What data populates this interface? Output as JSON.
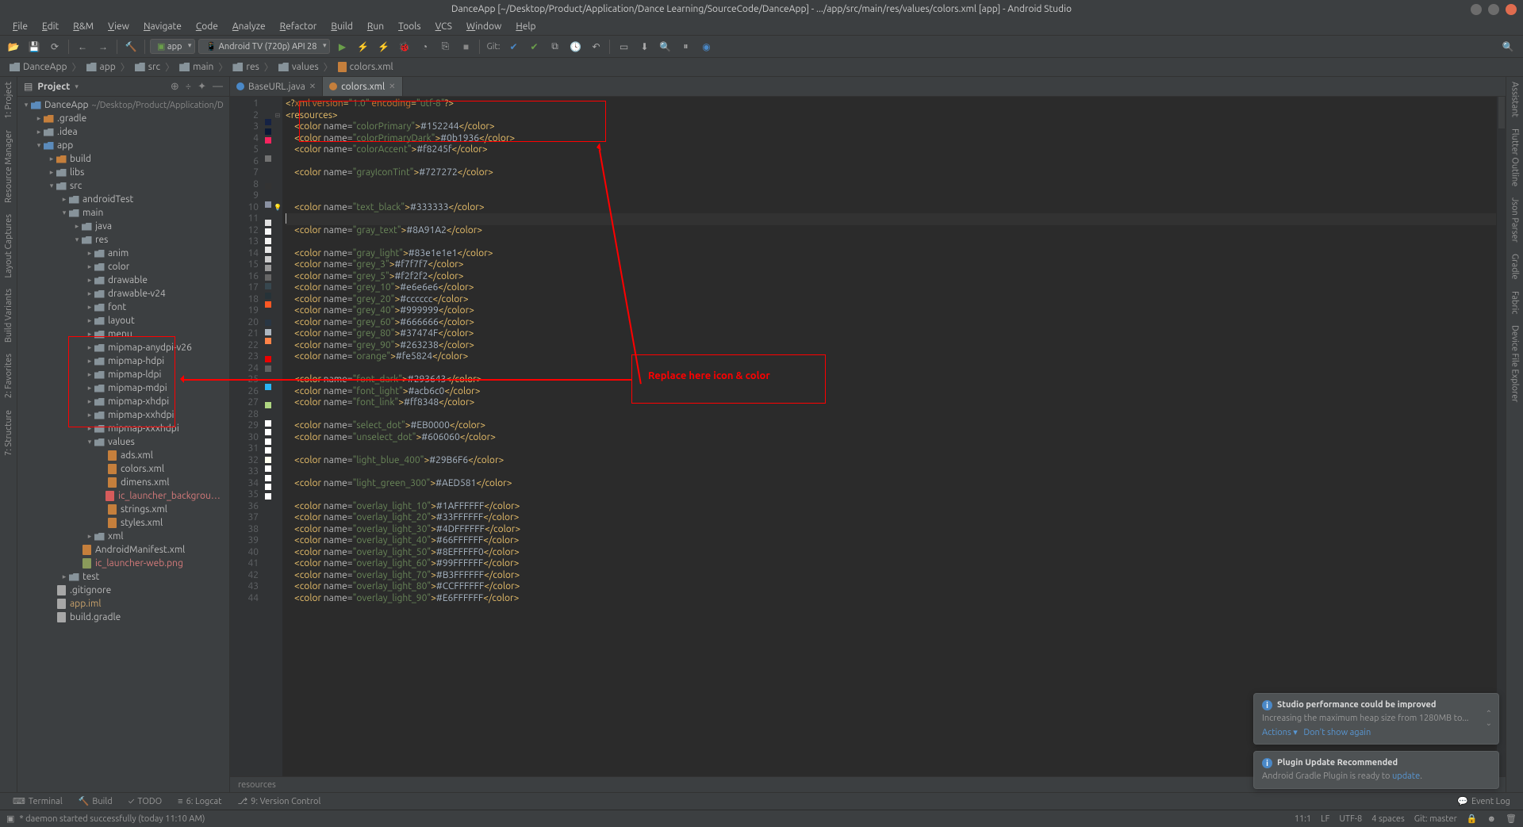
{
  "window": {
    "title": "DanceApp [~/Desktop/Product/Application/Dance Learning/SourceCode/DanceApp] - .../app/src/main/res/values/colors.xml [app] - Android Studio"
  },
  "menu": [
    "File",
    "Edit",
    "R&M",
    "View",
    "Navigate",
    "Code",
    "Analyze",
    "Refactor",
    "Build",
    "Run",
    "Tools",
    "VCS",
    "Window",
    "Help"
  ],
  "toolbar": {
    "config": "app",
    "device": "Android TV (720p) API 28",
    "git_label": "Git:"
  },
  "breadcrumb": [
    {
      "label": "DanceApp",
      "type": "project"
    },
    {
      "label": "app",
      "type": "module"
    },
    {
      "label": "src",
      "type": "folder"
    },
    {
      "label": "main",
      "type": "folder"
    },
    {
      "label": "res",
      "type": "folder"
    },
    {
      "label": "values",
      "type": "folder"
    },
    {
      "label": "colors.xml",
      "type": "file"
    }
  ],
  "project_panel": {
    "title": "Project",
    "root": "DanceApp",
    "root_path": "~/Desktop/Product/Application/D",
    "tree": [
      {
        "d": 0,
        "ar": "▾",
        "ic": "folder-root",
        "label": "DanceApp",
        "suffix": "~/Desktop/Product/Application/D"
      },
      {
        "d": 1,
        "ar": "▸",
        "ic": "folder-orange",
        "label": ".gradle"
      },
      {
        "d": 1,
        "ar": "▸",
        "ic": "folder",
        "label": ".idea"
      },
      {
        "d": 1,
        "ar": "▾",
        "ic": "folder-blue",
        "label": "app"
      },
      {
        "d": 2,
        "ar": "▸",
        "ic": "folder-orange",
        "label": "build"
      },
      {
        "d": 2,
        "ar": "▸",
        "ic": "folder",
        "label": "libs"
      },
      {
        "d": 2,
        "ar": "▾",
        "ic": "folder",
        "label": "src"
      },
      {
        "d": 3,
        "ar": "▸",
        "ic": "folder",
        "label": "androidTest"
      },
      {
        "d": 3,
        "ar": "▾",
        "ic": "folder",
        "label": "main"
      },
      {
        "d": 4,
        "ar": "▸",
        "ic": "folder",
        "label": "java"
      },
      {
        "d": 4,
        "ar": "▾",
        "ic": "folder",
        "label": "res"
      },
      {
        "d": 5,
        "ar": "▸",
        "ic": "folder",
        "label": "anim"
      },
      {
        "d": 5,
        "ar": "▸",
        "ic": "folder",
        "label": "color"
      },
      {
        "d": 5,
        "ar": "▸",
        "ic": "folder",
        "label": "drawable"
      },
      {
        "d": 5,
        "ar": "▸",
        "ic": "folder",
        "label": "drawable-v24"
      },
      {
        "d": 5,
        "ar": "▸",
        "ic": "folder",
        "label": "font"
      },
      {
        "d": 5,
        "ar": "▸",
        "ic": "folder",
        "label": "layout"
      },
      {
        "d": 5,
        "ar": "▸",
        "ic": "folder",
        "label": "menu"
      },
      {
        "d": 5,
        "ar": "▸",
        "ic": "folder",
        "label": "mipmap-anydpi-v26"
      },
      {
        "d": 5,
        "ar": "▸",
        "ic": "folder",
        "label": "mipmap-hdpi"
      },
      {
        "d": 5,
        "ar": "▸",
        "ic": "folder",
        "label": "mipmap-ldpi"
      },
      {
        "d": 5,
        "ar": "▸",
        "ic": "folder",
        "label": "mipmap-mdpi"
      },
      {
        "d": 5,
        "ar": "▸",
        "ic": "folder",
        "label": "mipmap-xhdpi"
      },
      {
        "d": 5,
        "ar": "▸",
        "ic": "folder",
        "label": "mipmap-xxhdpi"
      },
      {
        "d": 5,
        "ar": "▸",
        "ic": "folder",
        "label": "mipmap-xxxhdpi"
      },
      {
        "d": 5,
        "ar": "▾",
        "ic": "folder",
        "label": "values"
      },
      {
        "d": 6,
        "ar": "",
        "ic": "file-xml",
        "label": "ads.xml"
      },
      {
        "d": 6,
        "ar": "",
        "ic": "file-xml",
        "label": "colors.xml"
      },
      {
        "d": 6,
        "ar": "",
        "ic": "file-xml",
        "label": "dimens.xml"
      },
      {
        "d": 6,
        "ar": "",
        "ic": "file-xml-r",
        "label": "ic_launcher_background.xml",
        "red": true
      },
      {
        "d": 6,
        "ar": "",
        "ic": "file-xml",
        "label": "strings.xml"
      },
      {
        "d": 6,
        "ar": "",
        "ic": "file-xml",
        "label": "styles.xml"
      },
      {
        "d": 5,
        "ar": "▸",
        "ic": "folder",
        "label": "xml"
      },
      {
        "d": 4,
        "ar": "",
        "ic": "file-xml",
        "label": "AndroidManifest.xml"
      },
      {
        "d": 4,
        "ar": "",
        "ic": "file-png",
        "label": "ic_launcher-web.png",
        "red": true
      },
      {
        "d": 3,
        "ar": "▸",
        "ic": "folder",
        "label": "test"
      },
      {
        "d": 2,
        "ar": "",
        "ic": "file",
        "label": ".gitignore"
      },
      {
        "d": 2,
        "ar": "",
        "ic": "file",
        "label": "app.iml",
        "orange": true
      },
      {
        "d": 2,
        "ar": "",
        "ic": "file",
        "label": "build.gradle"
      }
    ]
  },
  "editor": {
    "tabs": [
      {
        "label": "BaseURL.java",
        "type": "java",
        "active": false
      },
      {
        "label": "colors.xml",
        "type": "xml",
        "active": true
      }
    ],
    "breadcrumb_bottom": "resources",
    "lines": [
      {
        "n": 1,
        "c": "",
        "html": "<span class='tk-decl'>&lt;?</span><span class='tk-pi'>xml version</span><span class='tk-decl'>=</span><span class='tk-str'>\"1.0\"</span> <span class='tk-pi'>encoding</span><span class='tk-decl'>=</span><span class='tk-str'>\"utf-8\"</span><span class='tk-decl'>?&gt;</span>"
      },
      {
        "n": 2,
        "c": "",
        "fold": "⊟",
        "html": "<span class='tk-tag'>&lt;resources&gt;</span>"
      },
      {
        "n": 3,
        "c": "#152244",
        "html": "    <span class='tk-tag'>&lt;color </span><span class='tk-attr'>name=</span><span class='tk-str'>\"colorPrimary\"</span><span class='tk-tag'>&gt;</span>#152244<span class='tk-tag'>&lt;/color&gt;</span>"
      },
      {
        "n": 4,
        "c": "#0b1936",
        "html": "    <span class='tk-tag'>&lt;color </span><span class='tk-attr'>name=</span><span class='tk-str'>\"colorPrimaryDark\"</span><span class='tk-tag'>&gt;</span>#0b1936<span class='tk-tag'>&lt;/color&gt;</span>"
      },
      {
        "n": 5,
        "c": "#f8245f",
        "html": "    <span class='tk-tag'>&lt;color </span><span class='tk-attr'>name=</span><span class='tk-str'>\"colorAccent\"</span><span class='tk-tag'>&gt;</span>#f8245f<span class='tk-tag'>&lt;/color&gt;</span>"
      },
      {
        "n": 6,
        "c": "",
        "html": ""
      },
      {
        "n": 7,
        "c": "#727272",
        "html": "    <span class='tk-tag'>&lt;color </span><span class='tk-attr'>name=</span><span class='tk-str'>\"grayIconTint\"</span><span class='tk-tag'>&gt;</span>#727272<span class='tk-tag'>&lt;/color&gt;</span>"
      },
      {
        "n": 8,
        "c": "",
        "html": ""
      },
      {
        "n": 9,
        "c": "",
        "html": ""
      },
      {
        "n": 10,
        "c": "#333333",
        "bulb": true,
        "html": "    <span class='tk-tag'>&lt;color </span><span class='tk-attr'>name=</span><span class='tk-str'>\"text_black\"</span><span class='tk-tag'>&gt;</span>#333333<span class='tk-tag'>&lt;/color&gt;</span>"
      },
      {
        "n": 11,
        "c": "",
        "current": true,
        "html": "<span class='caret'></span>"
      },
      {
        "n": 12,
        "c": "#8A91A2",
        "html": "    <span class='tk-tag'>&lt;color </span><span class='tk-attr'>name=</span><span class='tk-str'>\"gray_text\"</span><span class='tk-tag'>&gt;</span>#8A91A2<span class='tk-tag'>&lt;/color&gt;</span>"
      },
      {
        "n": 13,
        "c": "",
        "html": ""
      },
      {
        "n": 14,
        "c": "#83e1e1e1",
        "html": "    <span class='tk-tag'>&lt;color </span><span class='tk-attr'>name=</span><span class='tk-str'>\"gray_light\"</span><span class='tk-tag'>&gt;</span>#83e1e1e1<span class='tk-tag'>&lt;/color&gt;</span>"
      },
      {
        "n": 15,
        "c": "#f7f7f7",
        "html": "    <span class='tk-tag'>&lt;color </span><span class='tk-attr'>name=</span><span class='tk-str'>\"grey_3\"</span><span class='tk-tag'>&gt;</span>#f7f7f7<span class='tk-tag'>&lt;/color&gt;</span>"
      },
      {
        "n": 16,
        "c": "#f2f2f2",
        "html": "    <span class='tk-tag'>&lt;color </span><span class='tk-attr'>name=</span><span class='tk-str'>\"grey_5\"</span><span class='tk-tag'>&gt;</span>#f2f2f2<span class='tk-tag'>&lt;/color&gt;</span>"
      },
      {
        "n": 17,
        "c": "#e6e6e6",
        "html": "    <span class='tk-tag'>&lt;color </span><span class='tk-attr'>name=</span><span class='tk-str'>\"grey_10\"</span><span class='tk-tag'>&gt;</span>#e6e6e6<span class='tk-tag'>&lt;/color&gt;</span>"
      },
      {
        "n": 18,
        "c": "#cccccc",
        "html": "    <span class='tk-tag'>&lt;color </span><span class='tk-attr'>name=</span><span class='tk-str'>\"grey_20\"</span><span class='tk-tag'>&gt;</span>#cccccc<span class='tk-tag'>&lt;/color&gt;</span>"
      },
      {
        "n": 19,
        "c": "#999999",
        "html": "    <span class='tk-tag'>&lt;color </span><span class='tk-attr'>name=</span><span class='tk-str'>\"grey_40\"</span><span class='tk-tag'>&gt;</span>#999999<span class='tk-tag'>&lt;/color&gt;</span>"
      },
      {
        "n": 20,
        "c": "#666666",
        "html": "    <span class='tk-tag'>&lt;color </span><span class='tk-attr'>name=</span><span class='tk-str'>\"grey_60\"</span><span class='tk-tag'>&gt;</span>#666666<span class='tk-tag'>&lt;/color&gt;</span>"
      },
      {
        "n": 21,
        "c": "#37474F",
        "html": "    <span class='tk-tag'>&lt;color </span><span class='tk-attr'>name=</span><span class='tk-str'>\"grey_80\"</span><span class='tk-tag'>&gt;</span>#37474F<span class='tk-tag'>&lt;/color&gt;</span>"
      },
      {
        "n": 22,
        "c": "#263238",
        "html": "    <span class='tk-tag'>&lt;color </span><span class='tk-attr'>name=</span><span class='tk-str'>\"grey_90\"</span><span class='tk-tag'>&gt;</span>#263238<span class='tk-tag'>&lt;/color&gt;</span>"
      },
      {
        "n": 23,
        "c": "#fe5824",
        "html": "    <span class='tk-tag'>&lt;color </span><span class='tk-attr'>name=</span><span class='tk-str'>\"orange\"</span><span class='tk-tag'>&gt;</span>#fe5824<span class='tk-tag'>&lt;/color&gt;</span>"
      },
      {
        "n": 24,
        "c": "",
        "html": ""
      },
      {
        "n": 25,
        "c": "#293643",
        "html": "    <span class='tk-tag'>&lt;color </span><span class='tk-attr'>name=</span><span class='tk-str'>\"font_dark\"</span><span class='tk-tag'>&gt;</span>#293643<span class='tk-tag'>&lt;/color&gt;</span>"
      },
      {
        "n": 26,
        "c": "#acb6c0",
        "html": "    <span class='tk-tag'>&lt;color </span><span class='tk-attr'>name=</span><span class='tk-str'>\"font_light\"</span><span class='tk-tag'>&gt;</span>#acb6c0<span class='tk-tag'>&lt;/color&gt;</span>"
      },
      {
        "n": 27,
        "c": "#ff8348",
        "html": "    <span class='tk-tag'>&lt;color </span><span class='tk-attr'>name=</span><span class='tk-str'>\"font_link\"</span><span class='tk-tag'>&gt;</span>#ff8348<span class='tk-tag'>&lt;/color&gt;</span>"
      },
      {
        "n": 28,
        "c": "",
        "html": ""
      },
      {
        "n": 29,
        "c": "#EB0000",
        "html": "    <span class='tk-tag'>&lt;color </span><span class='tk-attr'>name=</span><span class='tk-str'>\"select_dot\"</span><span class='tk-tag'>&gt;</span>#EB0000<span class='tk-tag'>&lt;/color&gt;</span>"
      },
      {
        "n": 30,
        "c": "#606060",
        "html": "    <span class='tk-tag'>&lt;color </span><span class='tk-attr'>name=</span><span class='tk-str'>\"unselect_dot\"</span><span class='tk-tag'>&gt;</span>#606060<span class='tk-tag'>&lt;/color&gt;</span>"
      },
      {
        "n": 31,
        "c": "",
        "html": ""
      },
      {
        "n": 32,
        "c": "#29B6F6",
        "html": "    <span class='tk-tag'>&lt;color </span><span class='tk-attr'>name=</span><span class='tk-str'>\"light_blue_400\"</span><span class='tk-tag'>&gt;</span>#29B6F6<span class='tk-tag'>&lt;/color&gt;</span>"
      },
      {
        "n": 33,
        "c": "",
        "html": ""
      },
      {
        "n": 34,
        "c": "#AED581",
        "html": "    <span class='tk-tag'>&lt;color </span><span class='tk-attr'>name=</span><span class='tk-str'>\"light_green_300\"</span><span class='tk-tag'>&gt;</span>#AED581<span class='tk-tag'>&lt;/color&gt;</span>"
      },
      {
        "n": 35,
        "c": "",
        "html": ""
      },
      {
        "n": 36,
        "c": "#1AFFFFFF",
        "html": "    <span class='tk-tag'>&lt;color </span><span class='tk-attr'>name=</span><span class='tk-str'>\"overlay_light_10\"</span><span class='tk-tag'>&gt;</span>#1AFFFFFF<span class='tk-tag'>&lt;/color&gt;</span>"
      },
      {
        "n": 37,
        "c": "#33FFFFFF",
        "html": "    <span class='tk-tag'>&lt;color </span><span class='tk-attr'>name=</span><span class='tk-str'>\"overlay_light_20\"</span><span class='tk-tag'>&gt;</span>#33FFFFFF<span class='tk-tag'>&lt;/color&gt;</span>"
      },
      {
        "n": 38,
        "c": "#4DFFFFFF",
        "html": "    <span class='tk-tag'>&lt;color </span><span class='tk-attr'>name=</span><span class='tk-str'>\"overlay_light_30\"</span><span class='tk-tag'>&gt;</span>#4DFFFFFF<span class='tk-tag'>&lt;/color&gt;</span>"
      },
      {
        "n": 39,
        "c": "#66FFFFFF",
        "html": "    <span class='tk-tag'>&lt;color </span><span class='tk-attr'>name=</span><span class='tk-str'>\"overlay_light_40\"</span><span class='tk-tag'>&gt;</span>#66FFFFFF<span class='tk-tag'>&lt;/color&gt;</span>"
      },
      {
        "n": 40,
        "c": "#8EFFFFF0",
        "html": "    <span class='tk-tag'>&lt;color </span><span class='tk-attr'>name=</span><span class='tk-str'>\"overlay_light_50\"</span><span class='tk-tag'>&gt;</span>#8EFFFFF0<span class='tk-tag'>&lt;/color&gt;</span>"
      },
      {
        "n": 41,
        "c": "#99FFFFFF",
        "html": "    <span class='tk-tag'>&lt;color </span><span class='tk-attr'>name=</span><span class='tk-str'>\"overlay_light_60\"</span><span class='tk-tag'>&gt;</span>#99FFFFFF<span class='tk-tag'>&lt;/color&gt;</span>"
      },
      {
        "n": 42,
        "c": "#B3FFFFFF",
        "html": "    <span class='tk-tag'>&lt;color </span><span class='tk-attr'>name=</span><span class='tk-str'>\"overlay_light_70\"</span><span class='tk-tag'>&gt;</span>#B3FFFFFF<span class='tk-tag'>&lt;/color&gt;</span>"
      },
      {
        "n": 43,
        "c": "#CCFFFFFF",
        "html": "    <span class='tk-tag'>&lt;color </span><span class='tk-attr'>name=</span><span class='tk-str'>\"overlay_light_80\"</span><span class='tk-tag'>&gt;</span>#CCFFFFFF<span class='tk-tag'>&lt;/color&gt;</span>"
      },
      {
        "n": 44,
        "c": "#E6FFFFFF",
        "html": "    <span class='tk-tag'>&lt;color </span><span class='tk-attr'>name=</span><span class='tk-str'>\"overlay_light_90\"</span><span class='tk-tag'>&gt;</span>#E6FFFFFF<span class='tk-tag'>&lt;/color&gt;</span>"
      }
    ]
  },
  "left_tools": [
    "1: Project",
    "Resource Manager",
    "Layout Captures",
    "Build Variants",
    "2: Favorites",
    "7: Structure"
  ],
  "right_tools": [
    "Assistant",
    "Flutter Outline",
    "Json Parser",
    "Gradle",
    "Fabric",
    "Device File Explorer"
  ],
  "bottom_tools": {
    "left": [
      "Terminal",
      "Build",
      "TODO",
      "6: Logcat",
      "9: Version Control"
    ],
    "right": "Event Log"
  },
  "status": {
    "left_msg": "* daemon started successfully (today 11:10 AM)",
    "pos": "11:1",
    "line_sep": "LF",
    "encoding": "UTF-8",
    "indent": "4 spaces",
    "branch": "Git: master"
  },
  "notifications": [
    {
      "title": "Studio performance could be improved",
      "msg": "Increasing the maximum heap size from 1280MB to...",
      "actions": [
        "Actions ▾",
        "Don't show again"
      ]
    },
    {
      "title": "Plugin Update Recommended",
      "msg_pre": "Android Gradle Plugin is ready to ",
      "link": "update",
      "msg_post": "."
    }
  ],
  "annotation": {
    "text": "Replace here icon & color"
  }
}
